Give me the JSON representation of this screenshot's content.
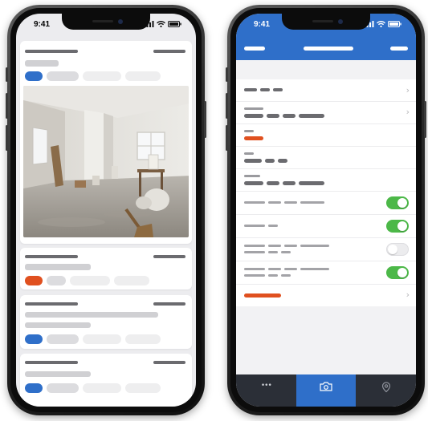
{
  "left_phone": {
    "status_time": "9:41"
  },
  "right_phone": {
    "status_time": "9:41",
    "settings": [
      {
        "type": "link",
        "accent": false
      },
      {
        "type": "link",
        "accent": false
      },
      {
        "type": "value",
        "accent": true
      },
      {
        "type": "value",
        "accent": false
      },
      {
        "type": "value",
        "accent": false
      },
      {
        "type": "toggle",
        "on": true
      },
      {
        "type": "toggle",
        "on": true
      },
      {
        "type": "toggle",
        "on": false
      },
      {
        "type": "toggle",
        "on": true
      },
      {
        "type": "link",
        "accent": true
      }
    ],
    "tabs": [
      {
        "icon": "more-dots-icon",
        "glyph": "•••",
        "active": false
      },
      {
        "icon": "camera-icon",
        "glyph": "",
        "active": true
      },
      {
        "icon": "location-pin-icon",
        "glyph": "",
        "active": false
      }
    ]
  },
  "colors": {
    "accent_blue": "#2f6fc9",
    "accent_orange": "#e0501f",
    "toggle_on": "#4cb848",
    "tabbar_bg": "#2b2f37"
  }
}
